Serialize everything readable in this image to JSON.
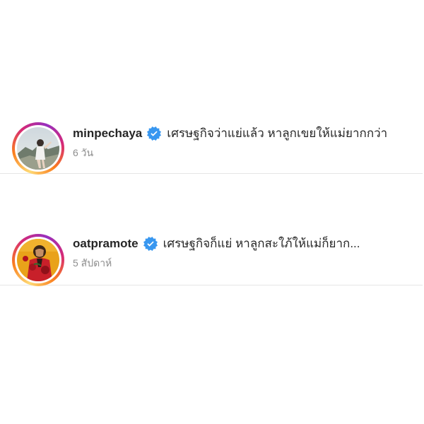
{
  "comments": [
    {
      "username": "minpechaya",
      "verified": true,
      "text": "เศรษฐกิจว่าแย่แล้ว หาลูกเขยให้แม่ยากกว่า",
      "time": "6 วัน"
    },
    {
      "username": "oatpramote",
      "verified": true,
      "text": "เศรษฐกิจก็แย่ หาลูกสะใภ้ให้แม่ก็ยาก...",
      "time": "5 สัปดาห์"
    }
  ],
  "colors": {
    "verified_badge": "#3897f0",
    "username_text": "#262626",
    "meta_text": "#8e8e8e",
    "divider": "#e6e6e6"
  },
  "icons": {
    "verified": "verified-badge-icon"
  }
}
